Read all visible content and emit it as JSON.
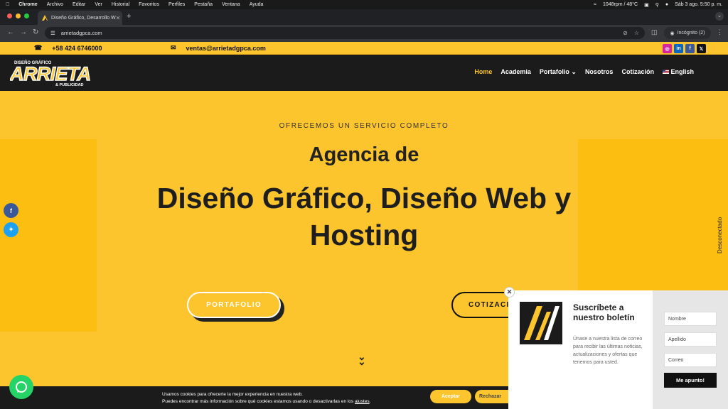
{
  "menubar": {
    "items": [
      "Chrome",
      "Archivo",
      "Editar",
      "Ver",
      "Historial",
      "Favoritos",
      "Perfiles",
      "Pestaña",
      "Ventana",
      "Ayuda"
    ],
    "status": "1048rpm / 48°C",
    "datetime": "Sáb 3 ago.  5:50 p. m."
  },
  "browser": {
    "tab_title": "Diseño Gráfico, Desarrollo W",
    "url": "arrietadgpca.com",
    "incognito_label": "Incógnito (2)"
  },
  "site": {
    "topbar": {
      "phone": "+58 424 6746000",
      "email": "ventas@arrietadgpca.com",
      "socials": [
        "instagram",
        "linkedin",
        "facebook",
        "x"
      ]
    },
    "logo": {
      "text": "ARRIETA",
      "top_caption": "DISEÑO GRÁFICO",
      "bottom_caption": "& PUBLICIDAD"
    },
    "nav": [
      {
        "label": "Home",
        "active": true
      },
      {
        "label": "Academia"
      },
      {
        "label": "Portafolio ⌄"
      },
      {
        "label": "Nosotros"
      },
      {
        "label": "Cotización"
      },
      {
        "label": "English"
      }
    ],
    "hero": {
      "eyebrow": "OFRECEMOS UN SERVICIO COMPLETO",
      "line1": "Agencia de",
      "line2": "Diseño Gráfico, Diseño Web y",
      "line3": "Hosting",
      "btn_portfolio": "PORTAFOLIO",
      "btn_cotizacion": "COTIZACIÓN"
    },
    "side_tab": "Desconectado",
    "popup": {
      "title": "Suscríbete a nuestro boletín",
      "description": "Únase a nuestra lista de correo para recibir las últimas noticias, actualizaciones y ofertas que tenemos para usted.",
      "field_nombre": "Nombre",
      "field_apellido": "Apellido",
      "field_correo": "Correo",
      "submit": "Me apunto!"
    },
    "cookie": {
      "line1": "Usamos cookies para ofrecerte la mejor experiencia en nuestra web.",
      "line2_prefix": "Puedes encontrar más información sobre qué cookies estamos usando o desactivarlas en los ",
      "line2_link": "ajustes",
      "line2_suffix": ".",
      "accept": "Aceptar",
      "reject": "Rechazar"
    }
  },
  "colors": {
    "brand_yellow": "#fcc42d",
    "dark": "#1b1b1b"
  }
}
